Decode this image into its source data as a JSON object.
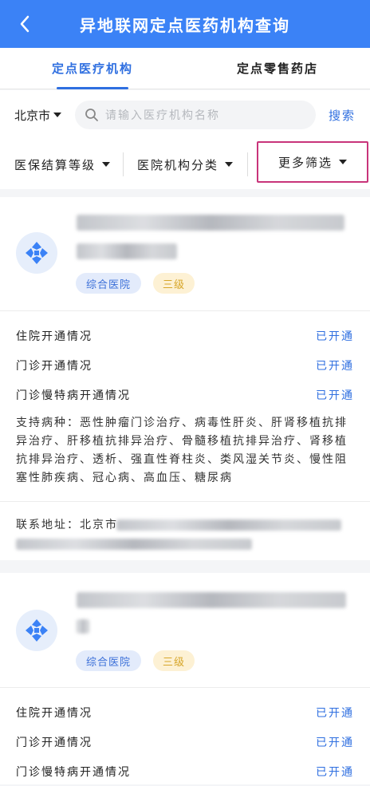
{
  "header": {
    "title": "异地联网定点医药机构查询"
  },
  "tabs": [
    {
      "label": "定点医疗机构",
      "active": true
    },
    {
      "label": "定点零售药店",
      "active": false
    }
  ],
  "search": {
    "city": "北京市",
    "placeholder": "请输入医疗机构名称",
    "button": "搜索"
  },
  "filters": [
    {
      "label": "医保结算等级"
    },
    {
      "label": "医院机构分类"
    },
    {
      "label": "更多筛选"
    }
  ],
  "cards": [
    {
      "type_badge": "综合医院",
      "level_badge": "三级",
      "rows": [
        {
          "label": "住院开通情况",
          "value": "已开通"
        },
        {
          "label": "门诊开通情况",
          "value": "已开通"
        },
        {
          "label": "门诊慢特病开通情况",
          "value": "已开通"
        }
      ],
      "diseases": "支持病种：恶性肿瘤门诊治疗、病毒性肝炎、肝肾移植抗排异治疗、肝移植抗排异治疗、骨髓移植抗排异治疗、肾移植抗排异治疗、透析、强直性脊柱炎、类风湿关节炎、慢性阻塞性肺疾病、冠心病、高血压、糖尿病",
      "address_label": "联系地址：北京市"
    },
    {
      "type_badge": "综合医院",
      "level_badge": "三级",
      "rows": [
        {
          "label": "住院开通情况",
          "value": "已开通"
        },
        {
          "label": "门诊开通情况",
          "value": "已开通"
        },
        {
          "label": "门诊慢特病开通情况",
          "value": "已开通"
        }
      ]
    }
  ],
  "colors": {
    "primary": "#3b82f6",
    "link": "#2f6fe0",
    "highlight_border": "#c8347a"
  },
  "icons": [
    "chevron-left-icon",
    "search-icon",
    "caret-down-icon",
    "hospital-cross-icon"
  ]
}
